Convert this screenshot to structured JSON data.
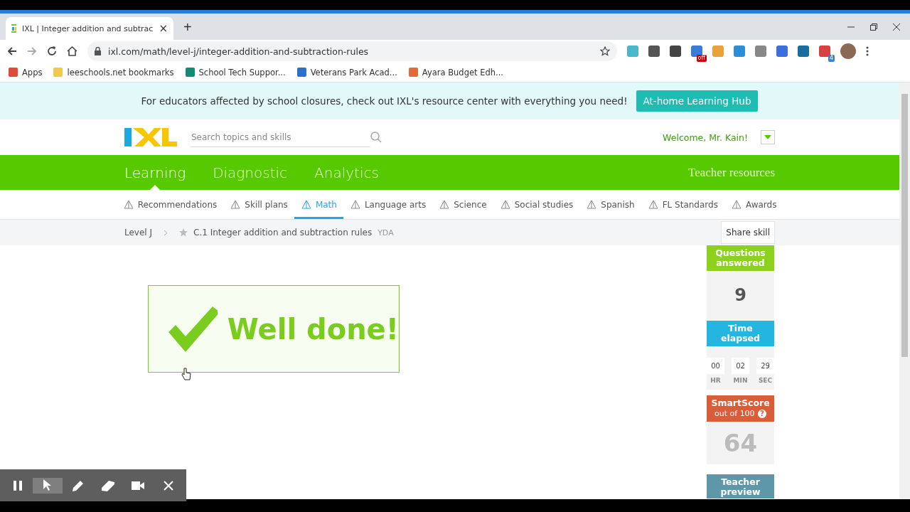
{
  "browser": {
    "tab": {
      "title": "IXL | Integer addition and subtrac",
      "close": "×"
    },
    "new_tab": "+",
    "url": "ixl.com/math/level-j/integer-addition-and-subtraction-rules",
    "extensions": [
      {
        "color": "#4bb8c8"
      },
      {
        "color": "#555555"
      },
      {
        "color": "#444444"
      },
      {
        "color": "#3a7bd5",
        "badge": "off"
      },
      {
        "color": "#e8a23a"
      },
      {
        "color": "#2c8fd6"
      },
      {
        "color": "#888888"
      },
      {
        "color": "#3b6fd9"
      },
      {
        "color": "#1a6e9e"
      },
      {
        "color": "#d94040",
        "badge": "4"
      }
    ],
    "bookmarks": [
      {
        "label": "Apps",
        "color": "#e04a3a"
      },
      {
        "label": "leeschools.net bookmarks",
        "color": "#f2c94c"
      },
      {
        "label": "School Tech Suppor...",
        "color": "#138a72"
      },
      {
        "label": "Veterans Park Acad...",
        "color": "#2a6fc9"
      },
      {
        "label": "Ayara Budget Edh...",
        "color": "#e36b3a"
      }
    ]
  },
  "banner": {
    "text": "For educators affected by school closures, check out IXL's resource center with everything you need!",
    "button": "At-home Learning Hub"
  },
  "header": {
    "search_placeholder": "Search topics and skills",
    "welcome": "Welcome, Mr. Kain!"
  },
  "nav": {
    "tabs": [
      {
        "label": "Learning",
        "selected": true
      },
      {
        "label": "Diagnostic",
        "selected": false
      },
      {
        "label": "Analytics",
        "selected": false
      }
    ],
    "teacher_resources": "Teacher resources"
  },
  "subnav": [
    {
      "label": "Recommendations",
      "selected": false
    },
    {
      "label": "Skill plans",
      "selected": false
    },
    {
      "label": "Math",
      "selected": true
    },
    {
      "label": "Language arts",
      "selected": false
    },
    {
      "label": "Science",
      "selected": false
    },
    {
      "label": "Social studies",
      "selected": false
    },
    {
      "label": "Spanish",
      "selected": false
    },
    {
      "label": "FL Standards",
      "selected": false
    },
    {
      "label": "Awards",
      "selected": false
    }
  ],
  "breadcrumb": {
    "level": "Level J",
    "skill": "C.1 Integer addition and subtraction rules",
    "code": "YDA",
    "share": "Share skill"
  },
  "feedback": {
    "message": "Well done!"
  },
  "stats": {
    "questions_label": "Questions answered",
    "questions": "9",
    "time_label": "Time elapsed",
    "time": [
      {
        "value": "00",
        "unit": "HR"
      },
      {
        "value": "02",
        "unit": "MIN"
      },
      {
        "value": "29",
        "unit": "SEC"
      }
    ],
    "smartscore_label": "SmartScore",
    "smartscore_sub": "out of 100",
    "help": "?",
    "score": "64",
    "teacher_preview": "Teacher preview"
  },
  "recorder": {
    "tools": [
      {
        "kind": "pause",
        "selected": false
      },
      {
        "kind": "pointer",
        "selected": true
      },
      {
        "kind": "pen",
        "selected": false
      },
      {
        "kind": "eraser",
        "selected": false
      },
      {
        "kind": "camera",
        "selected": false
      },
      {
        "kind": "close",
        "selected": false
      }
    ]
  }
}
